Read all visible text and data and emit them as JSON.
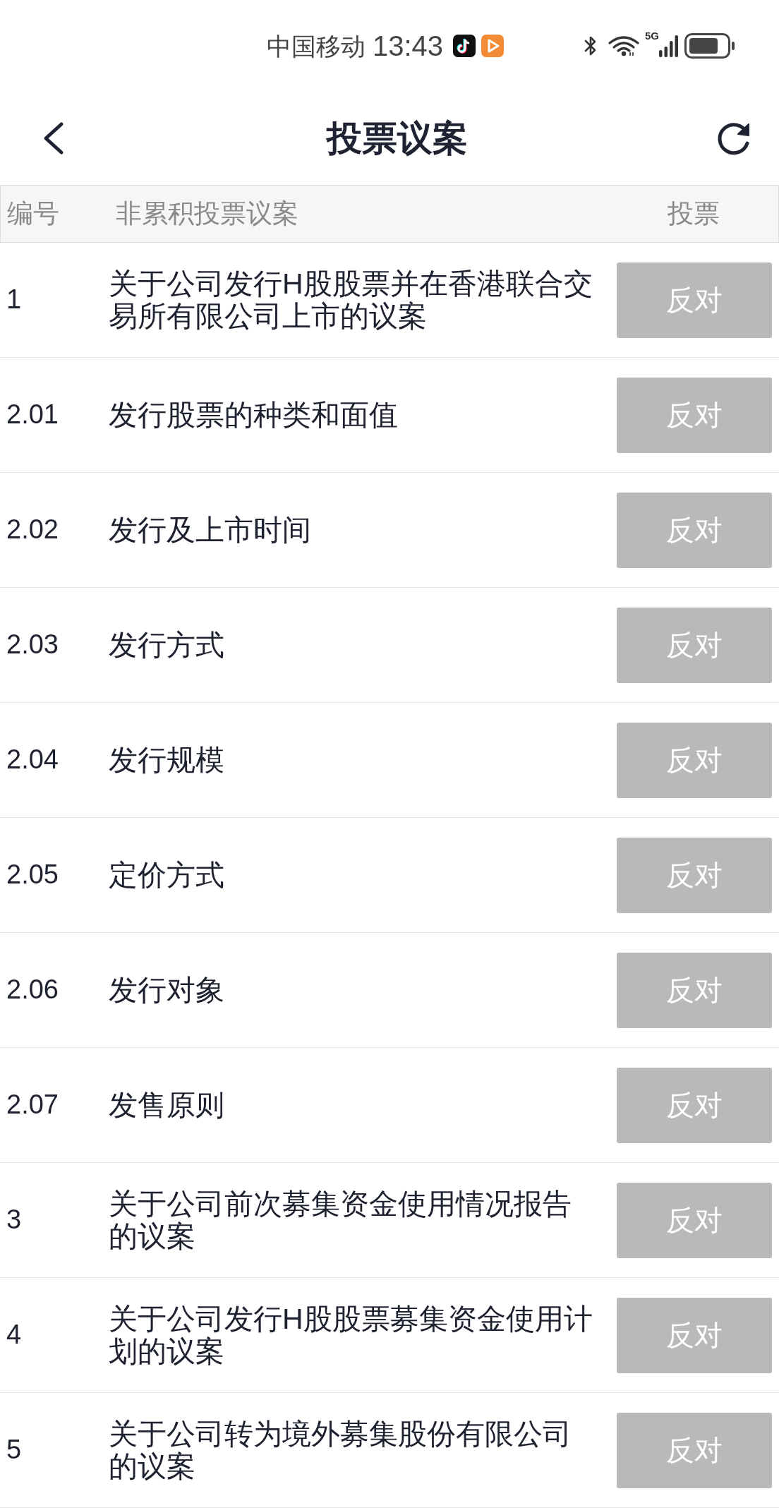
{
  "status_bar": {
    "carrier": "中国移动",
    "time": "13:43",
    "network": "5G"
  },
  "header": {
    "title": "投票议案"
  },
  "table": {
    "columns": [
      "编号",
      "非累积投票议案",
      "投票"
    ],
    "rows": [
      {
        "number": "1",
        "proposal": "关于公司发行H股股票并在香港联合交易所有限公司上市的议案",
        "vote": "反对"
      },
      {
        "number": "2.01",
        "proposal": "发行股票的种类和面值",
        "vote": "反对"
      },
      {
        "number": "2.02",
        "proposal": "发行及上市时间",
        "vote": "反对"
      },
      {
        "number": "2.03",
        "proposal": "发行方式",
        "vote": "反对"
      },
      {
        "number": "2.04",
        "proposal": "发行规模",
        "vote": "反对"
      },
      {
        "number": "2.05",
        "proposal": "定价方式",
        "vote": "反对"
      },
      {
        "number": "2.06",
        "proposal": "发行对象",
        "vote": "反对"
      },
      {
        "number": "2.07",
        "proposal": "发售原则",
        "vote": "反对"
      },
      {
        "number": "3",
        "proposal": "关于公司前次募集资金使用情况报告的议案",
        "vote": "反对"
      },
      {
        "number": "4",
        "proposal": "关于公司发行H股股票募集资金使用计划的议案",
        "vote": "反对"
      },
      {
        "number": "5",
        "proposal": "关于公司转为境外募集股份有限公司的议案",
        "vote": "反对"
      }
    ]
  }
}
